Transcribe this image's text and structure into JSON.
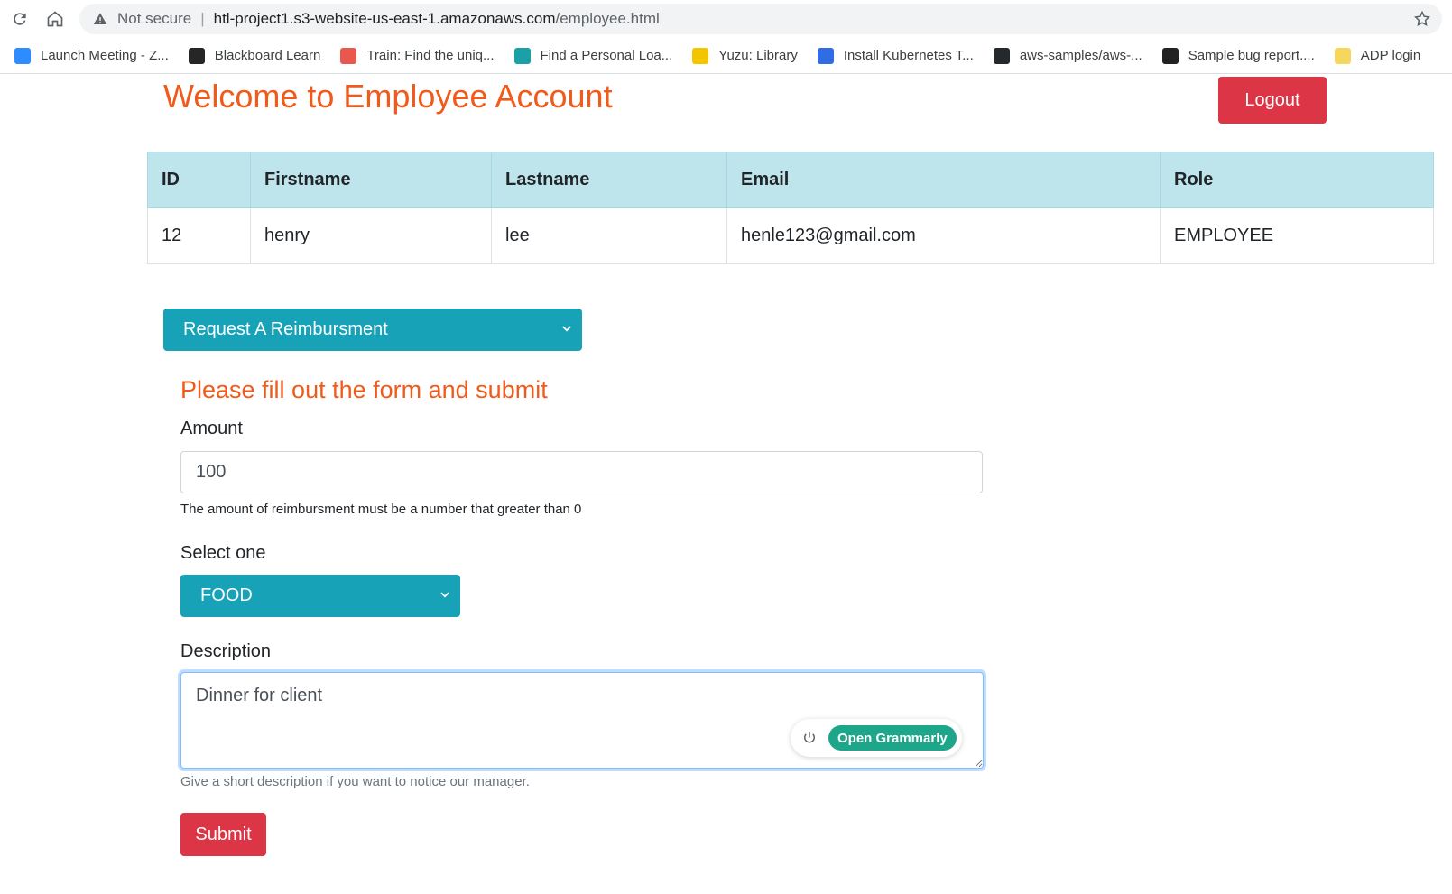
{
  "browser": {
    "security_label": "Not secure",
    "url_host": "htl-project1.s3-website-us-east-1.amazonaws.com",
    "url_path": "/employee.html",
    "bookmarks": [
      {
        "label": "Launch Meeting - Z...",
        "icon": "zoom-icon",
        "color": "#2d8cff"
      },
      {
        "label": "Blackboard Learn",
        "icon": "blackboard-icon",
        "color": "#262626"
      },
      {
        "label": "Train: Find the uniq...",
        "icon": "codesignal-icon",
        "color": "#e8584f"
      },
      {
        "label": "Find a Personal Loa...",
        "icon": "bank-icon",
        "color": "#1ba0a8"
      },
      {
        "label": "Yuzu: Library",
        "icon": "yuzu-icon",
        "color": "#f5c400"
      },
      {
        "label": "Install Kubernetes T...",
        "icon": "kubernetes-icon",
        "color": "#326ce5"
      },
      {
        "label": "aws-samples/aws-...",
        "icon": "github-icon",
        "color": "#24292e"
      },
      {
        "label": "Sample bug report....",
        "icon": "bug-report-icon",
        "color": "#222222"
      },
      {
        "label": "ADP login",
        "icon": "folder-icon",
        "color": "#f6d75e"
      }
    ]
  },
  "header": {
    "title": "Welcome to Employee Account",
    "logout_label": "Logout"
  },
  "employee_table": {
    "headers": [
      "ID",
      "Firstname",
      "Lastname",
      "Email",
      "Role"
    ],
    "row": [
      "12",
      "henry",
      "lee",
      "henle123@gmail.com",
      "EMPLOYEE"
    ]
  },
  "action_dropdown": {
    "label": "Request A Reimbursment"
  },
  "form": {
    "heading": "Please fill out the form and submit",
    "amount_label": "Amount",
    "amount_value": "100",
    "amount_help": "The amount of reimbursment must be a number that greater than 0",
    "type_label": "Select one",
    "type_value": "FOOD",
    "description_label": "Description",
    "description_value": "Dinner for client",
    "description_help": "Give a short description if you want to notice our manager.",
    "submit_label": "Submit"
  },
  "grammarly": {
    "button_label": "Open Grammarly"
  },
  "colors": {
    "accent_orange": "#f05a1a",
    "danger_red": "#dc3545",
    "info_teal": "#17a2b8",
    "table_header": "#bee5eb"
  }
}
